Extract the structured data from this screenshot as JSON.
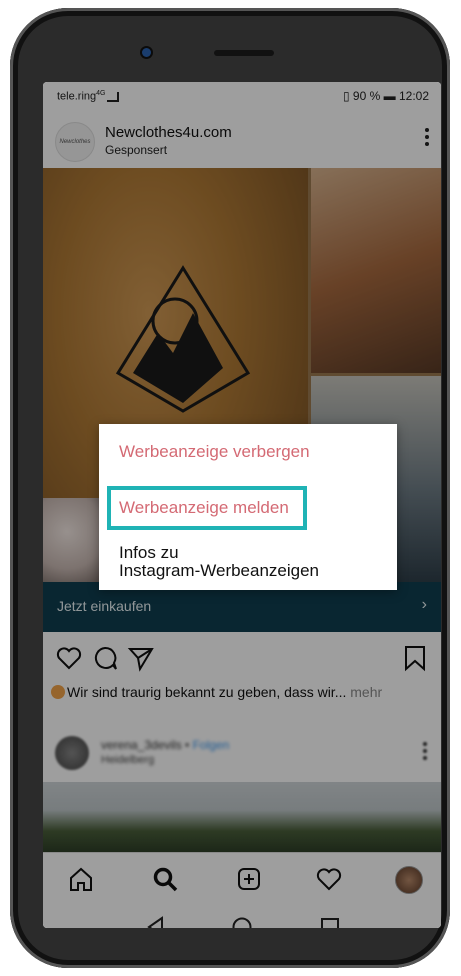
{
  "status_bar": {
    "carrier": "tele.ring",
    "net": "4G",
    "battery": "90 %",
    "time": "12:02"
  },
  "post": {
    "brand_logo_text": "Newclothes",
    "username": "Newclothes4u.com",
    "sponsored": "Gesponsert",
    "shop_label": "Jetzt einkaufen",
    "caption": "Wir sind traurig bekannt zu geben, dass wir...",
    "caption_more": "mehr"
  },
  "next_post": {
    "username": "verena_3devils",
    "follow": "Folgen",
    "location": "Heidelberg"
  },
  "menu": {
    "hide": "Werbeanzeige verbergen",
    "report": "Werbeanzeige melden",
    "info_line1": "Infos zu",
    "info_line2": "Instagram-Werbeanzeigen"
  },
  "colors": {
    "menu_red": "#d46a74",
    "highlight": "#1fb3b5",
    "shop_bar": "#0f3e4f"
  },
  "icons": {
    "actions": [
      "heart-icon",
      "comment-icon",
      "share-icon",
      "bookmark-icon"
    ],
    "bottom_nav": [
      "home-icon",
      "search-icon",
      "add-post-icon",
      "activity-heart-icon",
      "profile-avatar"
    ],
    "system_nav": [
      "back-icon",
      "home-circle-icon",
      "recents-icon"
    ]
  }
}
